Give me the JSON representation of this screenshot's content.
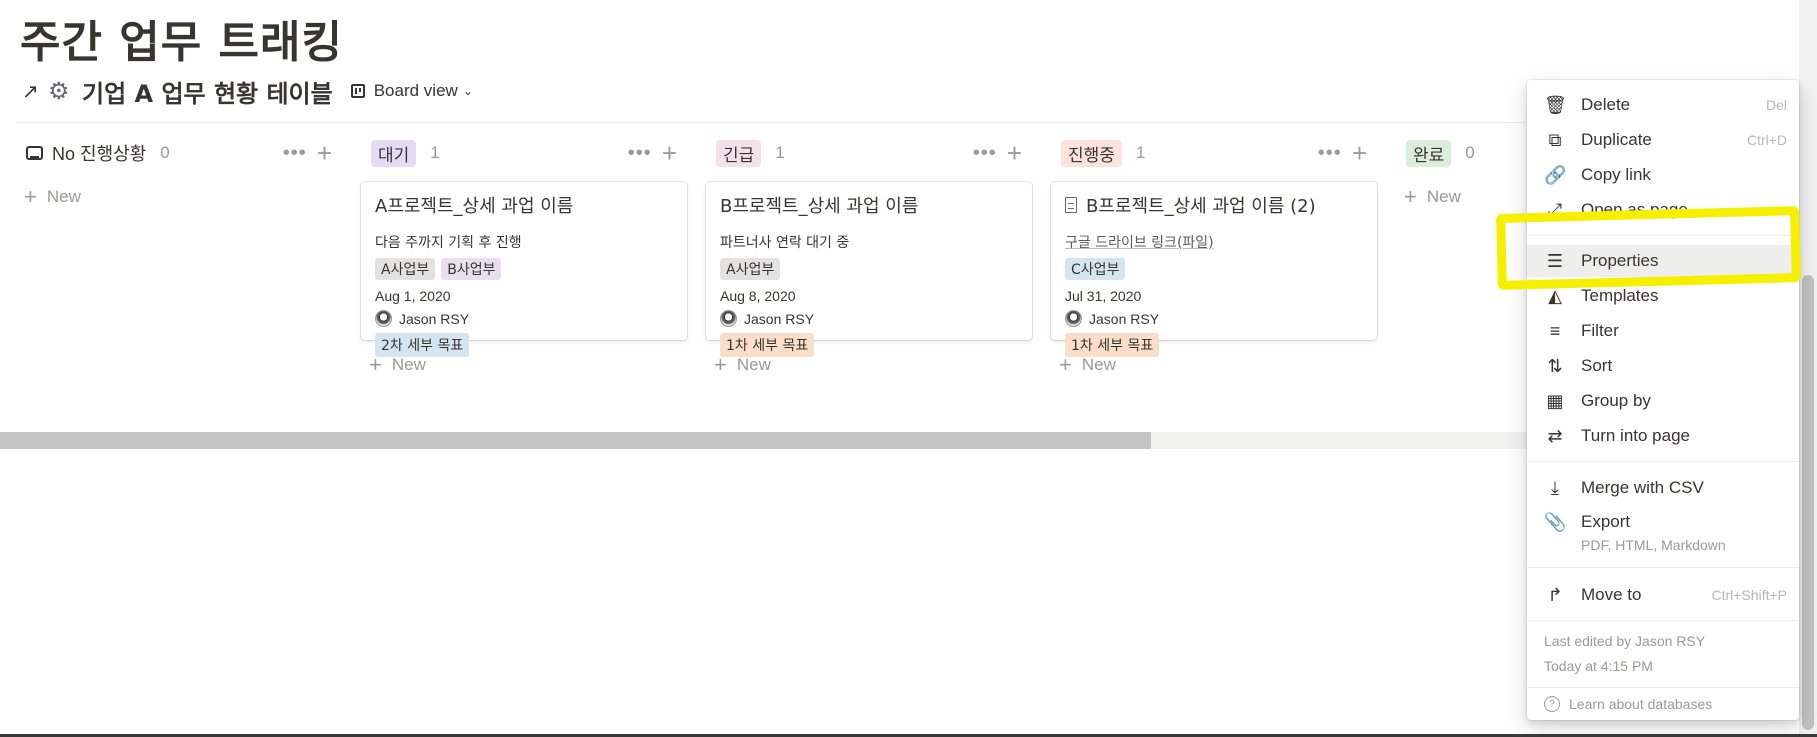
{
  "page": {
    "title": "주간 업무 트래킹"
  },
  "database": {
    "title": "기업 A 업무 현황 테이블",
    "view_label": "Board view"
  },
  "columns": [
    {
      "label": "No 진행상황",
      "count": "0",
      "tag_bg": "",
      "cards": []
    },
    {
      "label": "대기",
      "count": "1",
      "tag_bg": "#e6dbf5",
      "cards": [
        {
          "title": "A프로젝트_상세 과업 이름",
          "desc": "다음 주까지 기획 후 진행",
          "tags": [
            {
              "text": "A사업부",
              "bg": "#e3e2e0"
            },
            {
              "text": "B사업부",
              "bg": "#e8deee"
            }
          ],
          "date": "Aug 1, 2020",
          "person": "Jason RSY",
          "goal": "2차 세부 목표",
          "goal_bg": "#d3e5ef"
        }
      ]
    },
    {
      "label": "긴급",
      "count": "1",
      "tag_bg": "#f5e0e9",
      "cards": [
        {
          "title": "B프로젝트_상세 과업 이름",
          "desc": "파트너사 연락 대기 중",
          "tags": [
            {
              "text": "A사업부",
              "bg": "#e3e2e0"
            }
          ],
          "date": "Aug 8, 2020",
          "person": "Jason RSY",
          "goal": "1차 세부 목표",
          "goal_bg": "#fadec9"
        }
      ]
    },
    {
      "label": "진행중",
      "count": "1",
      "tag_bg": "#ffe2dd",
      "cards": [
        {
          "title": "B프로젝트_상세 과업 이름 (2)",
          "desc": "구글 드라이브 링크(파일)",
          "tags": [
            {
              "text": "C사업부",
              "bg": "#d3e5ef"
            }
          ],
          "date": "Jul 31, 2020",
          "person": "Jason RSY",
          "goal": "1차 세부 목표",
          "goal_bg": "#fadec9"
        }
      ]
    },
    {
      "label": "완료",
      "count": "0",
      "tag_bg": "#dbeddb",
      "cards": []
    }
  ],
  "board": {
    "new_label": "New"
  },
  "menu": {
    "items": [
      {
        "label": "Delete",
        "shortcut": "Del",
        "icon": "trash-icon"
      },
      {
        "label": "Duplicate",
        "shortcut": "Ctrl+D",
        "icon": "duplicate-icon"
      },
      {
        "label": "Copy link",
        "shortcut": "",
        "icon": "link-icon"
      },
      {
        "label": "Open as page",
        "shortcut": "",
        "icon": "expand-icon"
      },
      {
        "label": "Properties",
        "shortcut": "",
        "icon": "list-icon"
      },
      {
        "label": "Templates",
        "shortcut": "",
        "icon": "shapes-icon"
      },
      {
        "label": "Filter",
        "shortcut": "",
        "icon": "filter-icon"
      },
      {
        "label": "Sort",
        "shortcut": "",
        "icon": "sort-icon"
      },
      {
        "label": "Group by",
        "shortcut": "",
        "icon": "group-icon"
      },
      {
        "label": "Turn into page",
        "shortcut": "",
        "icon": "turn-into-icon"
      },
      {
        "label": "Merge with CSV",
        "shortcut": "",
        "icon": "download-icon"
      },
      {
        "label": "Export",
        "shortcut": "",
        "icon": "paperclip-icon"
      },
      {
        "label": "Move to",
        "shortcut": "Ctrl+Shift+P",
        "icon": "move-icon"
      }
    ],
    "export_formats": "PDF, HTML, Markdown",
    "last_edited": "Last edited by Jason RSY",
    "edited_time": "Today at 4:15 PM",
    "help": "Learn about databases"
  },
  "colors": {
    "highlight": "#f5ef00",
    "text": "#37352f",
    "muted": "#9b9a97"
  }
}
